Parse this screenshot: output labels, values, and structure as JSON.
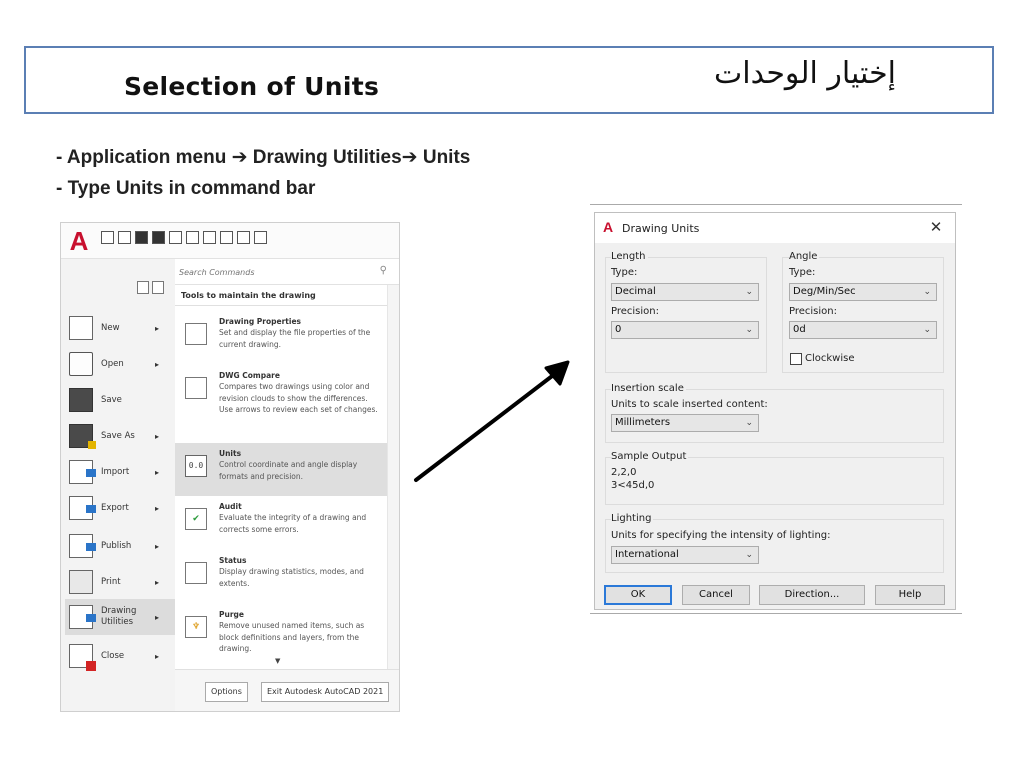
{
  "slide": {
    "title_en": "Selection of Units",
    "title_ar": "إختيار الوحدات",
    "bullet1_a": "- Application menu ",
    "bullet1_b": " Drawing Utilities",
    "bullet1_c": " Units",
    "bullet2": "- Type Units in command bar",
    "arrow_glyph": "➔"
  },
  "app_menu": {
    "logo": "A",
    "search_placeholder": "Search Commands",
    "search_icon": "⚲",
    "heading": "Tools to maintain the drawing",
    "items": [
      {
        "label": "New",
        "icon": "new-file-icon"
      },
      {
        "label": "Open",
        "icon": "open-folder-icon"
      },
      {
        "label": "Save",
        "icon": "save-icon"
      },
      {
        "label": "Save As",
        "icon": "save-as-icon"
      },
      {
        "label": "Import",
        "icon": "import-icon"
      },
      {
        "label": "Export",
        "icon": "export-icon"
      },
      {
        "label": "Publish",
        "icon": "publish-icon"
      },
      {
        "label": "Print",
        "icon": "print-icon"
      },
      {
        "label": "Drawing Utilities",
        "icon": "drawing-utilities-icon"
      },
      {
        "label": "Close",
        "icon": "close-file-icon"
      }
    ],
    "chevron": "▸",
    "tools": [
      {
        "name": "Drawing Properties",
        "desc": "Set and display the file properties of the current drawing."
      },
      {
        "name": "DWG Compare",
        "desc": "Compares two drawings using color and revision clouds to show the differences. Use arrows to review each set of changes."
      },
      {
        "name": "Units",
        "desc": "Control coordinate and angle display formats and precision.",
        "icon_text": "0.0"
      },
      {
        "name": "Audit",
        "desc": "Evaluate the integrity of a drawing and corrects some errors."
      },
      {
        "name": "Status",
        "desc": "Display drawing statistics, modes, and extents."
      },
      {
        "name": "Purge",
        "desc": "Remove unused named items, such as block definitions and layers, from the drawing."
      }
    ],
    "down_arrow": "▼",
    "options_button": "Options",
    "exit_button": "Exit Autodesk AutoCAD 2021"
  },
  "dialog": {
    "logo": "A",
    "title": "Drawing Units",
    "close": "✕",
    "length_group": "Length",
    "length_type_label": "Type:",
    "length_type_value": "Decimal",
    "length_precision_label": "Precision:",
    "length_precision_value": "0",
    "angle_group": "Angle",
    "angle_type_label": "Type:",
    "angle_type_value": "Deg/Min/Sec",
    "angle_precision_label": "Precision:",
    "angle_precision_value": "0d",
    "clockwise_label": "Clockwise",
    "insertion_group": "Insertion scale",
    "insertion_label": "Units to scale inserted content:",
    "insertion_value": "Millimeters",
    "sample_group": "Sample Output",
    "sample_line1": "2,2,0",
    "sample_line2": "3<45d,0",
    "lighting_group": "Lighting",
    "lighting_label": "Units for specifying the intensity of lighting:",
    "lighting_value": "International",
    "caret": "⌄",
    "ok": "OK",
    "cancel": "Cancel",
    "direction": "Direction...",
    "help": "Help"
  }
}
